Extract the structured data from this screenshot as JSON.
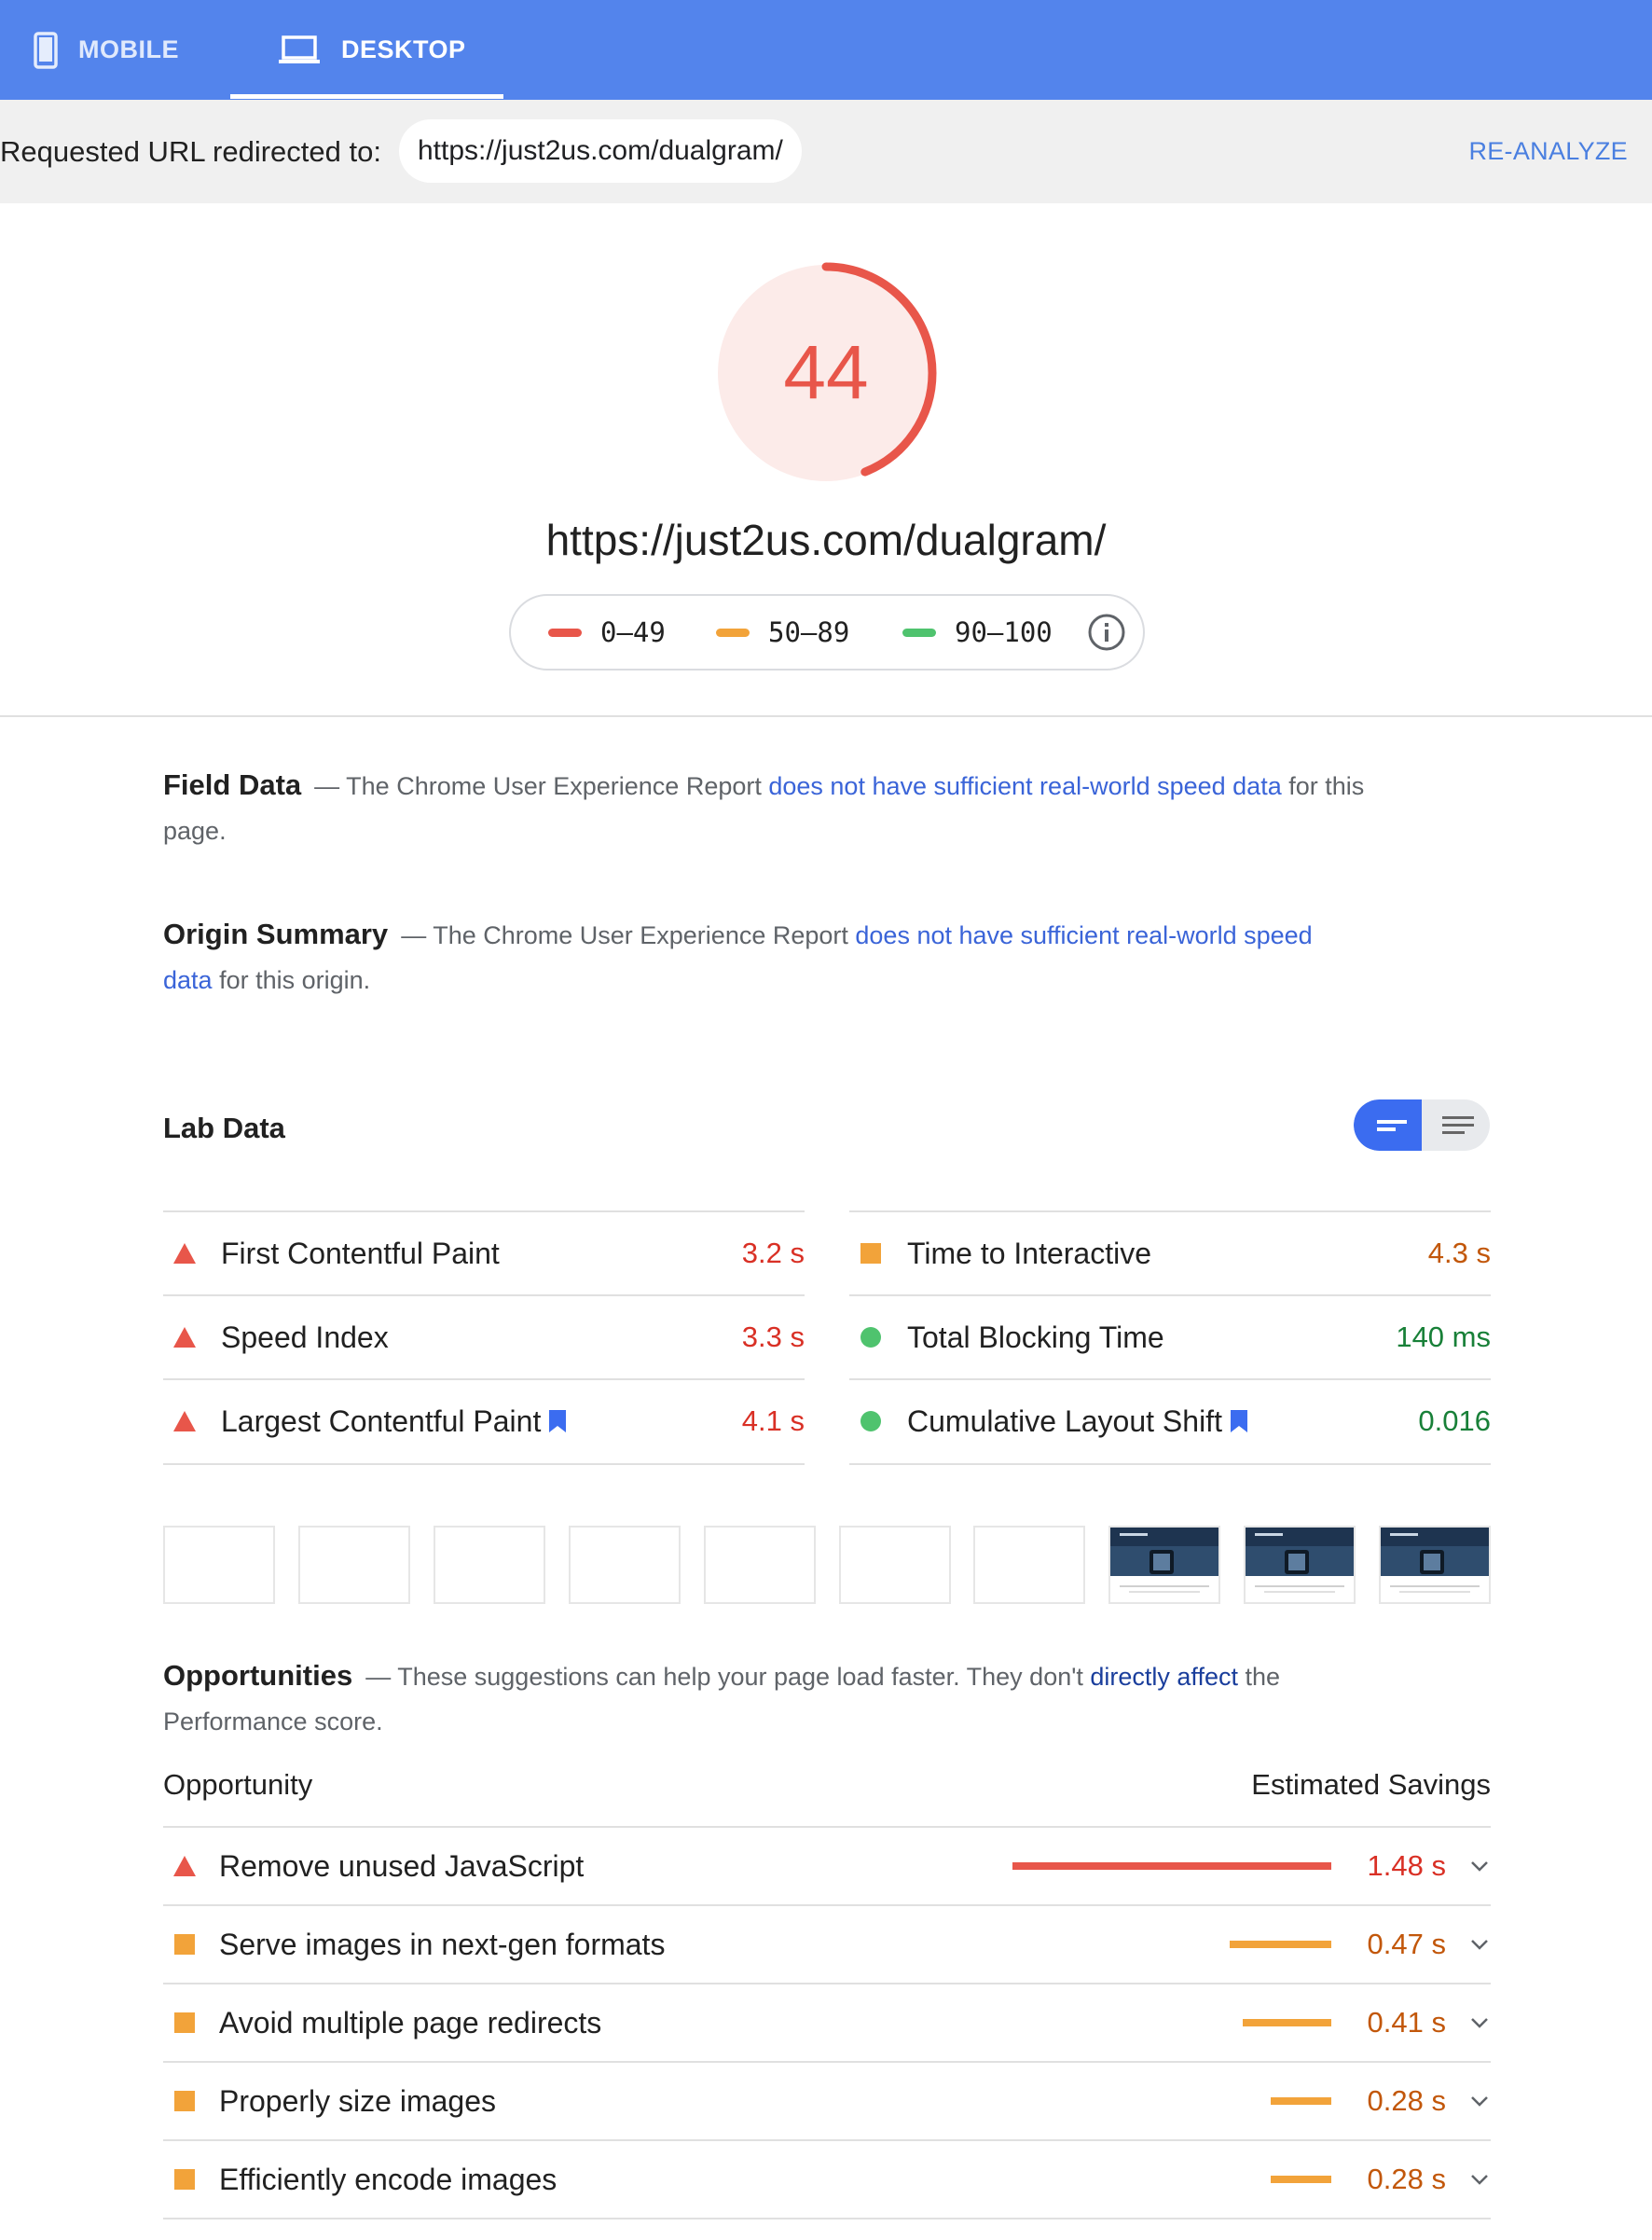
{
  "tabs": {
    "mobile_label": "MOBILE",
    "desktop_label": "DESKTOP",
    "active": "desktop"
  },
  "redirect": {
    "label": "Requested URL redirected to:",
    "url": "https://just2us.com/dualgram/",
    "reanalyze_label": "RE-ANALYZE"
  },
  "score": {
    "value": "44",
    "fraction": 0.44,
    "url": "https://just2us.com/dualgram/"
  },
  "legend": {
    "fail": "0–49",
    "average": "50–89",
    "pass": "90–100",
    "icon": "info-icon"
  },
  "field_data": {
    "heading": "Field Data",
    "text_before": "— The Chrome User Experience Report ",
    "link": "does not have sufficient real-world speed data",
    "text_after": " for this page."
  },
  "origin_summary": {
    "heading": "Origin Summary",
    "text_before": "— The Chrome User Experience Report ",
    "link": "does not have sufficient real-world speed data",
    "text_after": " for this origin."
  },
  "lab_data": {
    "heading": "Lab Data",
    "metrics": [
      {
        "label": "First Contentful Paint",
        "value": "3.2 s",
        "status": "fail",
        "flag": false
      },
      {
        "label": "Speed Index",
        "value": "3.3 s",
        "status": "fail",
        "flag": false
      },
      {
        "label": "Largest Contentful Paint",
        "value": "4.1 s",
        "status": "fail",
        "flag": true
      },
      {
        "label": "Time to Interactive",
        "value": "4.3 s",
        "status": "average",
        "flag": false
      },
      {
        "label": "Total Blocking Time",
        "value": "140 ms",
        "status": "pass",
        "flag": false
      },
      {
        "label": "Cumulative Layout Shift",
        "value": "0.016",
        "status": "pass",
        "flag": true
      }
    ]
  },
  "opportunities": {
    "heading": "Opportunities",
    "text_before": "— These suggestions can help your page load faster. They don't ",
    "link": "directly affect",
    "text_after": " the Performance score.",
    "col_left": "Opportunity",
    "col_right": "Estimated Savings",
    "items": [
      {
        "label": "Remove unused JavaScript",
        "savings": "1.48 s",
        "seconds": 1.48,
        "status": "fail"
      },
      {
        "label": "Serve images in next-gen formats",
        "savings": "0.47 s",
        "seconds": 0.47,
        "status": "average"
      },
      {
        "label": "Avoid multiple page redirects",
        "savings": "0.41 s",
        "seconds": 0.41,
        "status": "average"
      },
      {
        "label": "Properly size images",
        "savings": "0.28 s",
        "seconds": 0.28,
        "status": "average"
      },
      {
        "label": "Efficiently encode images",
        "savings": "0.28 s",
        "seconds": 0.28,
        "status": "average"
      }
    ]
  },
  "colors": {
    "header_blue": "#5384ec",
    "fail": "#e8564a",
    "average": "#f2a33a",
    "pass": "#4fc36e",
    "link": "#3a64d8"
  }
}
